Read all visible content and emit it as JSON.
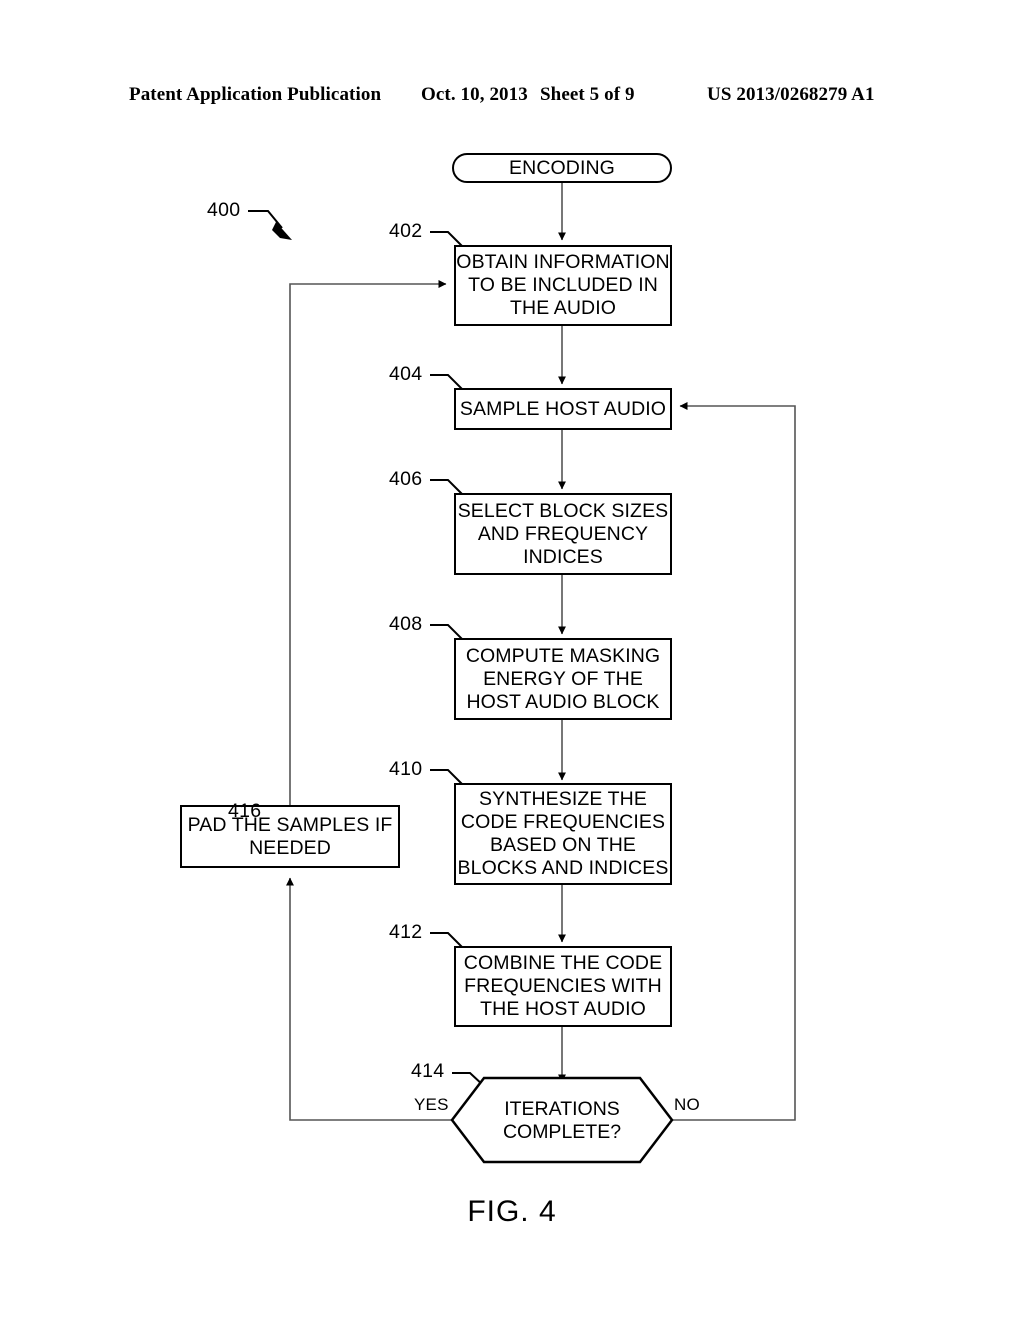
{
  "header": {
    "publication": "Patent Application Publication",
    "date": "Oct. 10, 2013",
    "sheet": "Sheet 5 of 9",
    "patent_number": "US 2013/0268279 A1"
  },
  "figure": {
    "caption": "FIG. 4",
    "diagram_ref": "400"
  },
  "nodes": {
    "start": {
      "ref": "",
      "label": "ENCODING",
      "shape": "terminal"
    },
    "obtain_info": {
      "ref": "402",
      "label": "OBTAIN INFORMATION TO BE INCLUDED IN THE AUDIO",
      "shape": "process"
    },
    "sample_host": {
      "ref": "404",
      "label": "SAMPLE HOST AUDIO",
      "shape": "process"
    },
    "select_blocks": {
      "ref": "406",
      "label": "SELECT BLOCK SIZES AND FREQUENCY INDICES",
      "shape": "process"
    },
    "compute_masking": {
      "ref": "408",
      "label": "COMPUTE MASKING ENERGY OF THE HOST AUDIO BLOCK",
      "shape": "process"
    },
    "synthesize": {
      "ref": "410",
      "label": "SYNTHESIZE THE CODE FREQUENCIES BASED ON THE BLOCKS AND INDICES",
      "shape": "process"
    },
    "combine": {
      "ref": "412",
      "label": "COMBINE THE CODE FREQUENCIES WITH THE HOST AUDIO",
      "shape": "process"
    },
    "iterations": {
      "ref": "414",
      "label": "ITERATIONS COMPLETE?",
      "shape": "decision"
    },
    "pad_samples": {
      "ref": "416",
      "label": "PAD THE SAMPLES IF NEEDED",
      "shape": "process"
    }
  },
  "branches": {
    "yes": "YES",
    "no": "NO"
  }
}
